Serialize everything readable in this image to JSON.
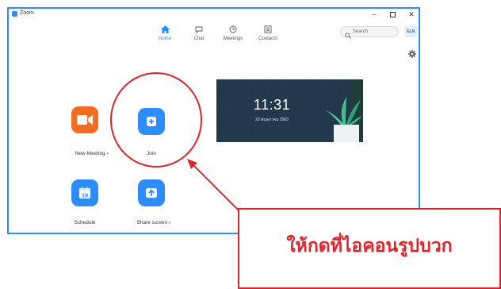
{
  "window": {
    "title": "Zoom"
  },
  "nav": {
    "tabs": [
      {
        "label": "Home",
        "icon": "home-icon",
        "active": true
      },
      {
        "label": "Chat",
        "icon": "chat-icon",
        "active": false
      },
      {
        "label": "Meetings",
        "icon": "clock-icon",
        "active": false
      },
      {
        "label": "Contacts",
        "icon": "contacts-icon",
        "active": false
      }
    ]
  },
  "search": {
    "placeholder": "Search"
  },
  "avatar": {
    "text": "GLN"
  },
  "actions": {
    "new_meeting": {
      "label": "New Meeting",
      "color": "#f26d21"
    },
    "join": {
      "label": "Join",
      "color": "#2d8cff"
    },
    "schedule": {
      "label": "Schedule",
      "color": "#2d8cff",
      "day": "19"
    },
    "share_screen": {
      "label": "Share screen",
      "color": "#2d8cff"
    }
  },
  "banner": {
    "time": "11:31",
    "date": "23 พฤษภาคม 2563"
  },
  "callout": {
    "text": "ให้กดที่ไอคอนรูปบวก",
    "color": "#d9262c"
  }
}
